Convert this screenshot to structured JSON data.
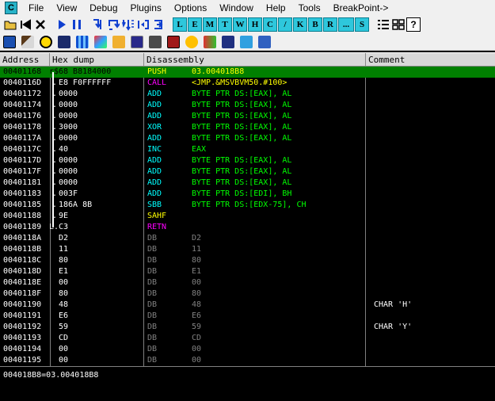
{
  "menu": {
    "app_icon": "C",
    "items": [
      "File",
      "View",
      "Debug",
      "Plugins",
      "Options",
      "Window",
      "Help",
      "Tools",
      "BreakPoint->"
    ]
  },
  "toolbar1": {
    "letters": [
      "L",
      "E",
      "M",
      "T",
      "W",
      "H",
      "C",
      "/",
      "K",
      "B",
      "R",
      "...",
      "S"
    ]
  },
  "columns": {
    "address": "Address",
    "hex": "Hex dump",
    "disasm": "Disassembly",
    "comment": "Comment"
  },
  "colors": {
    "selection": "#008000",
    "mnem_default": "#00ffff",
    "call": "#ff00ff",
    "retn": "#ff00ff",
    "push": "#ffff00",
    "sahf": "#ffff00",
    "data": "#808080",
    "operand_default": "#00ff00"
  },
  "rows": [
    {
      "addr": "00401168",
      "mark": "r$",
      "hex": "68 B8184000",
      "mnem": "PUSH",
      "ops": "03.004018B8",
      "cmt": "",
      "kind": "push",
      "sel": true
    },
    {
      "addr": "0040116D",
      "mark": ".",
      "hex": "E8 F0FFFFFF",
      "mnem": "CALL",
      "ops": "<JMP.&MSVBVM50.#100>",
      "cmt": "",
      "kind": "call"
    },
    {
      "addr": "00401172",
      "mark": ".",
      "hex": "0000",
      "mnem": "ADD",
      "ops": "BYTE PTR DS:[EAX], AL",
      "cmt": "",
      "kind": "op"
    },
    {
      "addr": "00401174",
      "mark": ".",
      "hex": "0000",
      "mnem": "ADD",
      "ops": "BYTE PTR DS:[EAX], AL",
      "cmt": "",
      "kind": "op"
    },
    {
      "addr": "00401176",
      "mark": ".",
      "hex": "0000",
      "mnem": "ADD",
      "ops": "BYTE PTR DS:[EAX], AL",
      "cmt": "",
      "kind": "op"
    },
    {
      "addr": "00401178",
      "mark": ".",
      "hex": "3000",
      "mnem": "XOR",
      "ops": "BYTE PTR DS:[EAX], AL",
      "cmt": "",
      "kind": "op"
    },
    {
      "addr": "0040117A",
      "mark": ".",
      "hex": "0000",
      "mnem": "ADD",
      "ops": "BYTE PTR DS:[EAX], AL",
      "cmt": "",
      "kind": "op"
    },
    {
      "addr": "0040117C",
      "mark": ".",
      "hex": "40",
      "mnem": "INC",
      "ops": "EAX",
      "cmt": "",
      "kind": "op"
    },
    {
      "addr": "0040117D",
      "mark": ".",
      "hex": "0000",
      "mnem": "ADD",
      "ops": "BYTE PTR DS:[EAX], AL",
      "cmt": "",
      "kind": "op"
    },
    {
      "addr": "0040117F",
      "mark": ".",
      "hex": "0000",
      "mnem": "ADD",
      "ops": "BYTE PTR DS:[EAX], AL",
      "cmt": "",
      "kind": "op"
    },
    {
      "addr": "00401181",
      "mark": ".",
      "hex": "0000",
      "mnem": "ADD",
      "ops": "BYTE PTR DS:[EAX], AL",
      "cmt": "",
      "kind": "op"
    },
    {
      "addr": "00401183",
      "mark": ".",
      "hex": "003F",
      "mnem": "ADD",
      "ops": "BYTE PTR DS:[EDI], BH",
      "cmt": "",
      "kind": "op"
    },
    {
      "addr": "00401185",
      "mark": ".",
      "hex": "186A 8B",
      "mnem": "SBB",
      "ops": "BYTE PTR DS:[EDX-75], CH",
      "cmt": "",
      "kind": "op"
    },
    {
      "addr": "00401188",
      "mark": ".",
      "hex": "9E",
      "mnem": "SAHF",
      "ops": "",
      "cmt": "",
      "kind": "sahf"
    },
    {
      "addr": "00401189",
      "mark": "L.",
      "hex": "C3",
      "mnem": "RETN",
      "ops": "",
      "cmt": "",
      "kind": "retn"
    },
    {
      "addr": "0040118A",
      "mark": "",
      "hex": "D2",
      "mnem": "DB",
      "ops": "D2",
      "cmt": "",
      "kind": "data"
    },
    {
      "addr": "0040118B",
      "mark": "",
      "hex": "11",
      "mnem": "DB",
      "ops": "11",
      "cmt": "",
      "kind": "data"
    },
    {
      "addr": "0040118C",
      "mark": "",
      "hex": "80",
      "mnem": "DB",
      "ops": "80",
      "cmt": "",
      "kind": "data"
    },
    {
      "addr": "0040118D",
      "mark": "",
      "hex": "E1",
      "mnem": "DB",
      "ops": "E1",
      "cmt": "",
      "kind": "data"
    },
    {
      "addr": "0040118E",
      "mark": "",
      "hex": "00",
      "mnem": "DB",
      "ops": "00",
      "cmt": "",
      "kind": "data"
    },
    {
      "addr": "0040118F",
      "mark": "",
      "hex": "80",
      "mnem": "DB",
      "ops": "80",
      "cmt": "",
      "kind": "data"
    },
    {
      "addr": "00401190",
      "mark": "",
      "hex": "48",
      "mnem": "DB",
      "ops": "48",
      "cmt": "CHAR 'H'",
      "kind": "data"
    },
    {
      "addr": "00401191",
      "mark": "",
      "hex": "E6",
      "mnem": "DB",
      "ops": "E6",
      "cmt": "",
      "kind": "data"
    },
    {
      "addr": "00401192",
      "mark": "",
      "hex": "59",
      "mnem": "DB",
      "ops": "59",
      "cmt": "CHAR 'Y'",
      "kind": "data"
    },
    {
      "addr": "00401193",
      "mark": "",
      "hex": "CD",
      "mnem": "DB",
      "ops": "CD",
      "cmt": "",
      "kind": "data"
    },
    {
      "addr": "00401194",
      "mark": "",
      "hex": "00",
      "mnem": "DB",
      "ops": "00",
      "cmt": "",
      "kind": "data"
    },
    {
      "addr": "00401195",
      "mark": "",
      "hex": "00",
      "mnem": "DB",
      "ops": "00",
      "cmt": "",
      "kind": "data"
    }
  ],
  "info": "004018B8=03.004018B8"
}
